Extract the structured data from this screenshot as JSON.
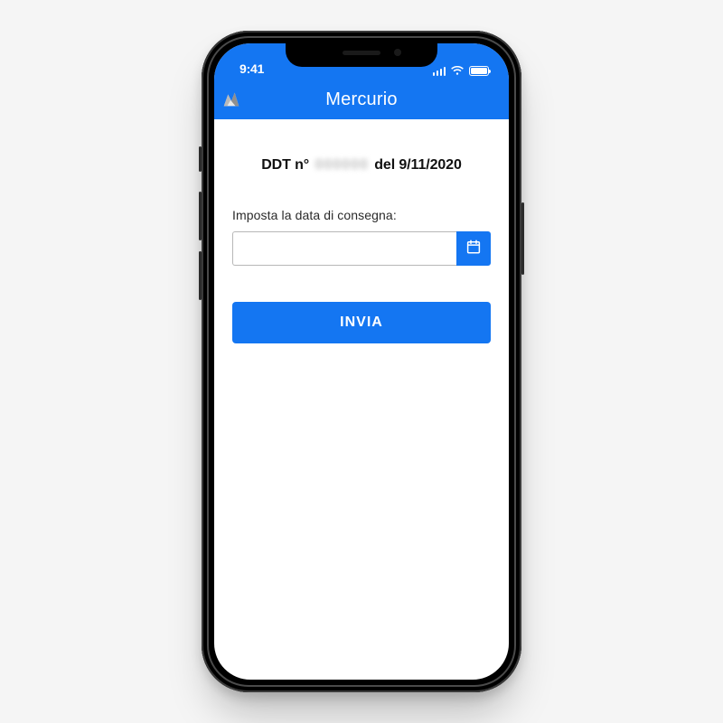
{
  "status": {
    "time": "9:41"
  },
  "header": {
    "title": "Mercurio"
  },
  "ddt": {
    "prefix": "DDT n°",
    "number_masked": "000000",
    "suffix": "del 9/11/2020"
  },
  "form": {
    "label": "Imposta la data di consegna:",
    "date_value": "",
    "date_placeholder": "",
    "submit_label": "INVIA"
  },
  "colors": {
    "brand_blue": "#1476f2"
  }
}
